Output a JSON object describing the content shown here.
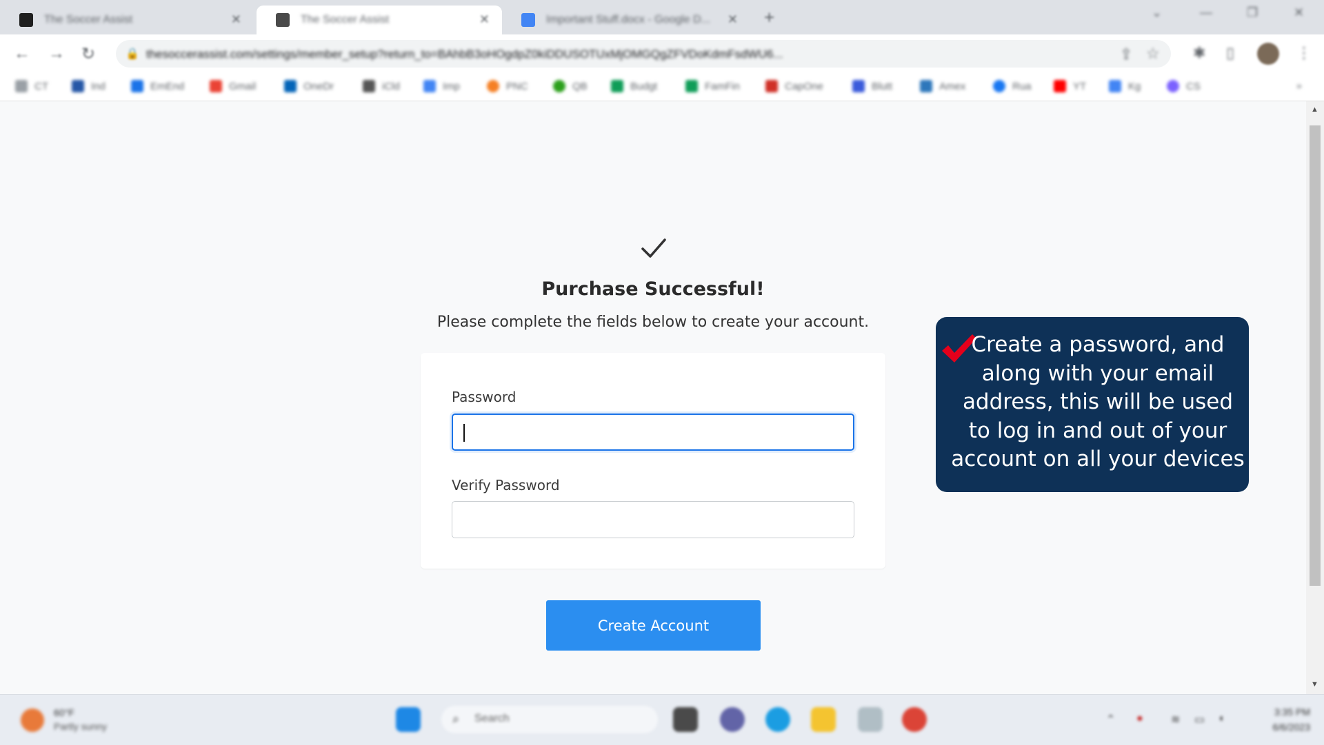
{
  "browser": {
    "tabs": [
      {
        "title": "The Soccer Assist",
        "favicon_color": "#1f1f1f",
        "active": false
      },
      {
        "title": "The Soccer Assist",
        "favicon_color": "#4a4a4a",
        "active": true
      },
      {
        "title": "Important Stuff.docx - Google D...",
        "favicon_color": "#4285f4",
        "active": false
      }
    ],
    "url": "thesoccerassist.com/settings/member_setup?return_to=BAhbB3oHOgdpZ0kiDDUSOTUxMjOMGQgZFVDoKdmFsdWU6...",
    "bookmarks": [
      {
        "label": "CT",
        "color": "#9aa0a6"
      },
      {
        "label": "Ind",
        "color": "#2557a7"
      },
      {
        "label": "EmEnd",
        "color": "#1a73e8"
      },
      {
        "label": "Gmail",
        "color": "#ea4335"
      },
      {
        "label": "OneDr",
        "color": "#0364b8"
      },
      {
        "label": "iCld",
        "color": "#555555"
      },
      {
        "label": "Imp",
        "color": "#4285f4"
      },
      {
        "label": "PNC",
        "color": "#f58025"
      },
      {
        "label": "QB",
        "color": "#2ca01c"
      },
      {
        "label": "Budgt",
        "color": "#0f9d58"
      },
      {
        "label": "FamFin",
        "color": "#0f9d58"
      },
      {
        "label": "CapOne",
        "color": "#d03027"
      },
      {
        "label": "Blutt",
        "color": "#3b5bdb"
      },
      {
        "label": "Amex",
        "color": "#2e77bb"
      },
      {
        "label": "Rua",
        "color": "#1877f2"
      },
      {
        "label": "YT",
        "color": "#ff0000"
      },
      {
        "label": "Kg",
        "color": "#4285f4"
      },
      {
        "label": "CS",
        "color": "#7b61ff"
      }
    ]
  },
  "page": {
    "headline": "Purchase Successful!",
    "subheadline": "Please complete the fields below to create your account.",
    "password_label": "Password",
    "verify_label": "Verify Password",
    "password_value": "",
    "verify_value": "",
    "create_button": "Create Account",
    "callout_text": "Create a password, and along with your email address, this will be used to log in and out of your account on all your devices",
    "colors": {
      "button": "#2b8ef0",
      "callout": "#0e3157",
      "check_red": "#e4001b",
      "focus": "#1a73e8"
    }
  },
  "taskbar": {
    "weather_temp": "60°F",
    "weather_desc": "Partly sunny",
    "search_placeholder": "Search",
    "time": "3:35 PM",
    "date": "6/6/2023"
  }
}
